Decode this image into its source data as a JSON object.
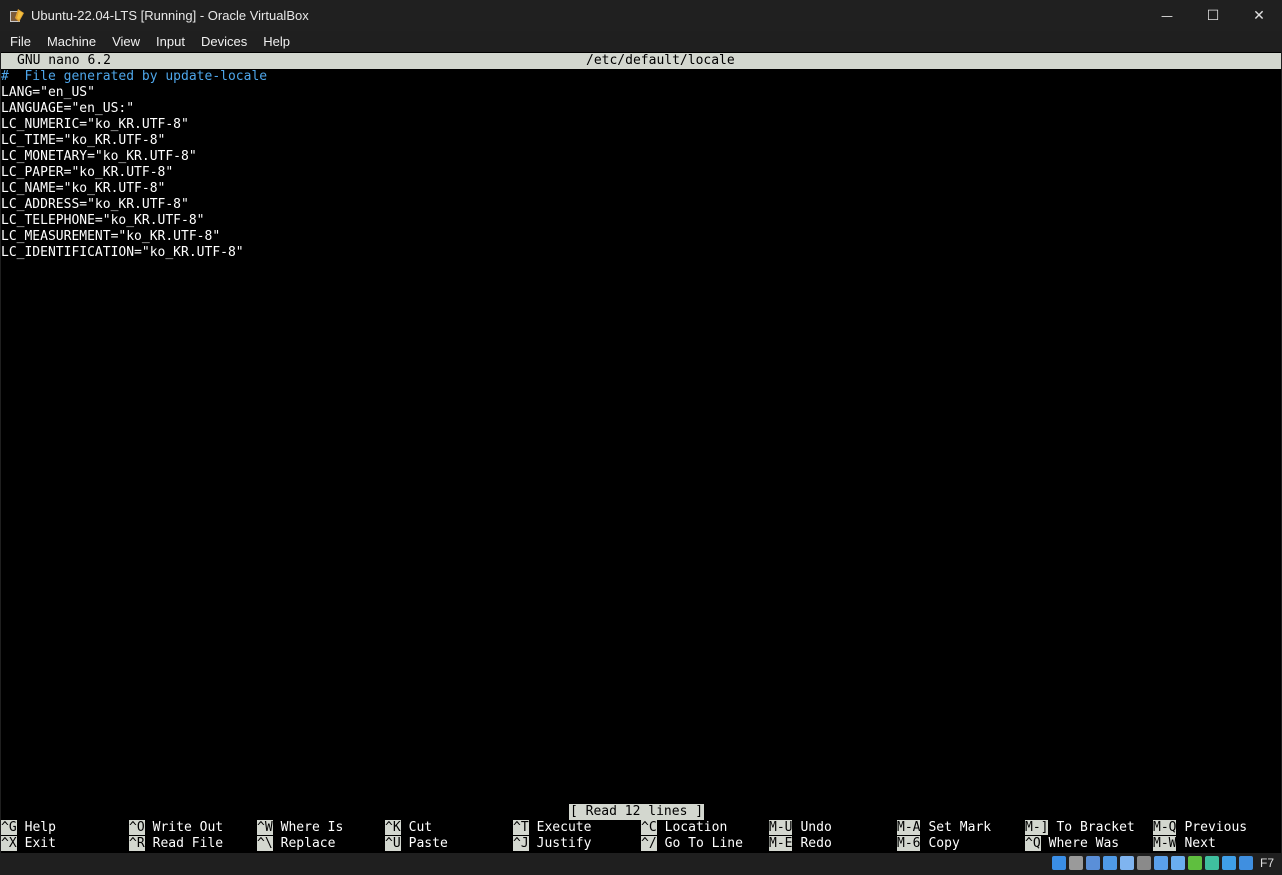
{
  "window": {
    "title": "Ubuntu-22.04-LTS [Running] - Oracle VirtualBox",
    "minimize_glyph": "—",
    "maximize_glyph": "☐",
    "close_glyph": "✕"
  },
  "menu": [
    "File",
    "Machine",
    "View",
    "Input",
    "Devices",
    "Help"
  ],
  "nano": {
    "version": "GNU nano 6.2",
    "filename": "/etc/default/locale",
    "lines": [
      "#  File generated by update-locale",
      "LANG=\"en_US\"",
      "LANGUAGE=\"en_US:\"",
      "LC_NUMERIC=\"ko_KR.UTF-8\"",
      "LC_TIME=\"ko_KR.UTF-8\"",
      "LC_MONETARY=\"ko_KR.UTF-8\"",
      "LC_PAPER=\"ko_KR.UTF-8\"",
      "LC_NAME=\"ko_KR.UTF-8\"",
      "LC_ADDRESS=\"ko_KR.UTF-8\"",
      "LC_TELEPHONE=\"ko_KR.UTF-8\"",
      "LC_MEASUREMENT=\"ko_KR.UTF-8\"",
      "LC_IDENTIFICATION=\"ko_KR.UTF-8\""
    ],
    "status": "[ Read 12 lines ]",
    "shortcuts_row1": [
      {
        "key": "^G",
        "label": "Help"
      },
      {
        "key": "^O",
        "label": "Write Out"
      },
      {
        "key": "^W",
        "label": "Where Is"
      },
      {
        "key": "^K",
        "label": "Cut"
      },
      {
        "key": "^T",
        "label": "Execute"
      },
      {
        "key": "^C",
        "label": "Location"
      },
      {
        "key": "M-U",
        "label": "Undo"
      },
      {
        "key": "M-A",
        "label": "Set Mark"
      },
      {
        "key": "M-]",
        "label": "To Bracket"
      },
      {
        "key": "M-Q",
        "label": "Previous"
      }
    ],
    "shortcuts_row2": [
      {
        "key": "^X",
        "label": "Exit"
      },
      {
        "key": "^R",
        "label": "Read File"
      },
      {
        "key": "^\\",
        "label": "Replace"
      },
      {
        "key": "^U",
        "label": "Paste"
      },
      {
        "key": "^J",
        "label": "Justify"
      },
      {
        "key": "^/",
        "label": "Go To Line"
      },
      {
        "key": "M-E",
        "label": "Redo"
      },
      {
        "key": "M-6",
        "label": "Copy"
      },
      {
        "key": "^Q",
        "label": "Where Was"
      },
      {
        "key": "M-W",
        "label": "Next"
      }
    ]
  },
  "statusbar": {
    "host_key": "F7",
    "icons": [
      {
        "name": "hard-disk-icon",
        "color": "#3a8ee6"
      },
      {
        "name": "optical-drive-icon",
        "color": "#9a9a9a"
      },
      {
        "name": "audio-icon",
        "color": "#5a8fd8"
      },
      {
        "name": "network-icon",
        "color": "#4f9be8"
      },
      {
        "name": "usb-icon",
        "color": "#7fb4f0"
      },
      {
        "name": "shared-folders-icon",
        "color": "#8a8a8a"
      },
      {
        "name": "display-icon",
        "color": "#5aa0ea"
      },
      {
        "name": "video-capture-icon",
        "color": "#6aaef0"
      },
      {
        "name": "guest-additions-icon",
        "color": "#5fbf3f"
      },
      {
        "name": "cpu-icon",
        "color": "#3fbf9f"
      },
      {
        "name": "mouse-integration-icon",
        "color": "#3f9fe8"
      },
      {
        "name": "keyboard-capture-icon",
        "color": "#3f8fe0"
      }
    ]
  }
}
